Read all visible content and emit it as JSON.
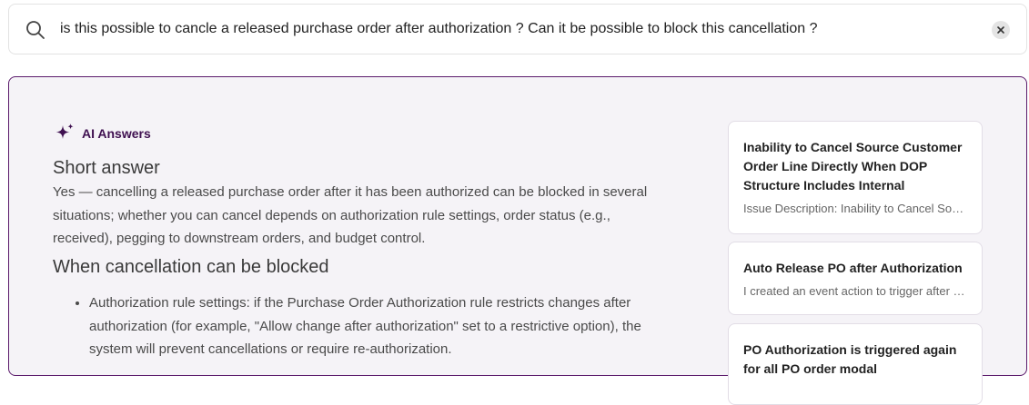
{
  "search": {
    "query": "is this possible to cancle a released purchase order after authorization ? Can it be possible to block this cancellation ?"
  },
  "ai_answers": {
    "label": "AI Answers",
    "short_answer_heading": "Short answer",
    "short_answer_text": "Yes — cancelling a released purchase order after it has been authorized can be blocked in several situations; whether you can cancel depends on authorization rule settings, order status (e.g., received), pegging to downstream orders, and budget control.",
    "blocked_heading": "When cancellation can be blocked",
    "bullets": [
      "Authorization rule settings: if the Purchase Order Authorization rule restricts changes after authorization (for example, \"Allow change after authorization\" set to a restrictive option), the system will prevent cancellations or require re-authorization."
    ]
  },
  "sources": [
    {
      "title": "Inability to Cancel Source Customer Order Line Directly When DOP Structure Includes Internal",
      "snippet": "Issue Description: Inability to Cancel Source Customer Order Line Directly"
    },
    {
      "title": "Auto Release PO after Authorization",
      "snippet": "I created an event action to trigger after authorization of PO"
    },
    {
      "title": "PO Authorization is triggered again for all PO order modal",
      "snippet": ""
    }
  ],
  "colors": {
    "accent": "#5b1a6b",
    "panel_bg": "#f5f3f7"
  },
  "icons": {
    "search": "search-icon",
    "clear": "close-icon",
    "ai": "sparkle-icon"
  }
}
